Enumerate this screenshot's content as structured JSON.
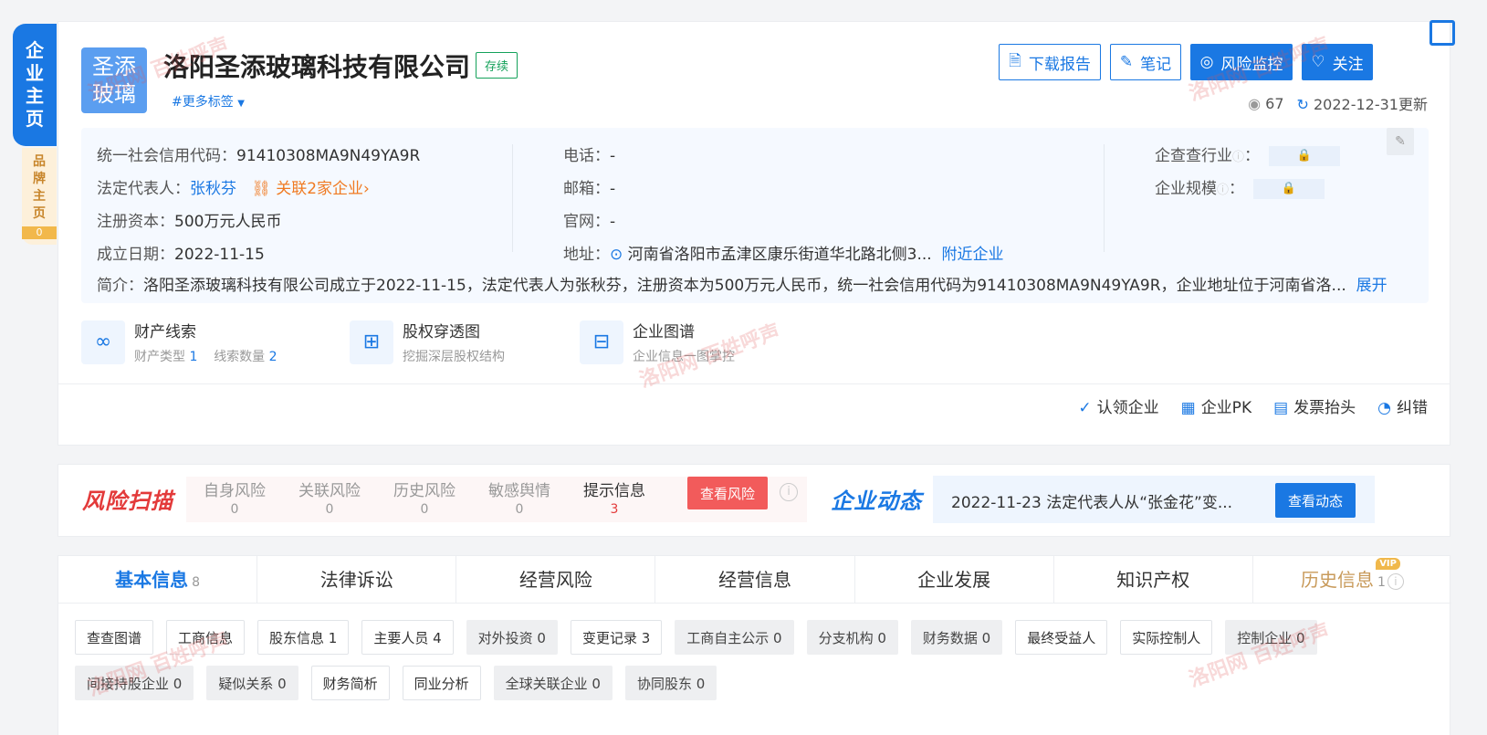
{
  "side": {
    "main_chars": [
      "企",
      "业",
      "主",
      "页"
    ],
    "brand_chars": [
      "品",
      "牌",
      "主",
      "页"
    ],
    "brand_count": "0"
  },
  "company": {
    "logo_line1": "圣添",
    "logo_line2": "玻璃",
    "name": "洛阳圣添玻璃科技有限公司",
    "status": "存续",
    "more_tags": "#更多标签"
  },
  "actions": {
    "download": "下载报告",
    "note": "笔记",
    "monitor": "风险监控",
    "follow": "关注"
  },
  "meta": {
    "views": "67",
    "updated": "2022-12-31更新"
  },
  "info": {
    "credit_label": "统一社会信用代码：",
    "credit_value": "91410308MA9N49YA9R",
    "legal_label": "法定代表人：",
    "legal_value": "张秋芬",
    "related": "关联2家企业",
    "capital_label": "注册资本：",
    "capital_value": "500万元人民币",
    "founded_label": "成立日期：",
    "founded_value": "2022-11-15",
    "phone_label": "电话：",
    "phone_value": "-",
    "email_label": "邮箱：",
    "email_value": "-",
    "website_label": "官网：",
    "website_value": "-",
    "address_label": "地址：",
    "address_value": "河南省洛阳市孟津区康乐街道华北路北侧3...",
    "nearby": "附近企业",
    "industry_label": "企查查行业",
    "scale_label": "企业规模",
    "intro_label": "简介：",
    "intro_value": "洛阳圣添玻璃科技有限公司成立于2022-11-15，法定代表人为张秋芬，注册资本为500万元人民币，统一社会信用代码为91410308MA9N49YA9R，企业地址位于河南省洛...",
    "expand": "展开"
  },
  "features": [
    {
      "title": "财产线索",
      "sub1": "财产类型",
      "n1": "1",
      "sub2": "线索数量",
      "n2": "2"
    },
    {
      "title": "股权穿透图",
      "sub": "挖掘深层股权结构"
    },
    {
      "title": "企业图谱",
      "sub": "企业信息一图掌控"
    }
  ],
  "tools": [
    "认领企业",
    "企业PK",
    "发票抬头",
    "纠错"
  ],
  "risk": {
    "logo": "风险扫描",
    "items": [
      {
        "label": "自身风险",
        "count": "0"
      },
      {
        "label": "关联风险",
        "count": "0"
      },
      {
        "label": "历史风险",
        "count": "0"
      },
      {
        "label": "敏感舆情",
        "count": "0"
      },
      {
        "label": "提示信息",
        "count": "3"
      }
    ],
    "button": "查看风险"
  },
  "dynamic": {
    "logo": "企业动态",
    "text": "2022-11-23 法定代表人从“张金花”变...",
    "button": "查看动态"
  },
  "tabs": [
    {
      "label": "基本信息",
      "count": "8"
    },
    {
      "label": "法律诉讼"
    },
    {
      "label": "经营风险"
    },
    {
      "label": "经营信息"
    },
    {
      "label": "企业发展"
    },
    {
      "label": "知识产权"
    },
    {
      "label": "历史信息",
      "count": "1",
      "badge": "VIP"
    }
  ],
  "chips": [
    "查查图谱",
    "工商信息",
    "股东信息 1",
    "主要人员 4",
    "对外投资 0",
    "变更记录 3",
    "工商自主公示 0",
    "分支机构 0",
    "财务数据 0",
    "最终受益人",
    "实际控制人",
    "控制企业 0",
    "间接持股企业 0",
    "疑似关系 0",
    "财务简析",
    "同业分析",
    "全球关联企业 0",
    "协同股东 0"
  ],
  "watermark": "洛阳网 百姓呼声"
}
